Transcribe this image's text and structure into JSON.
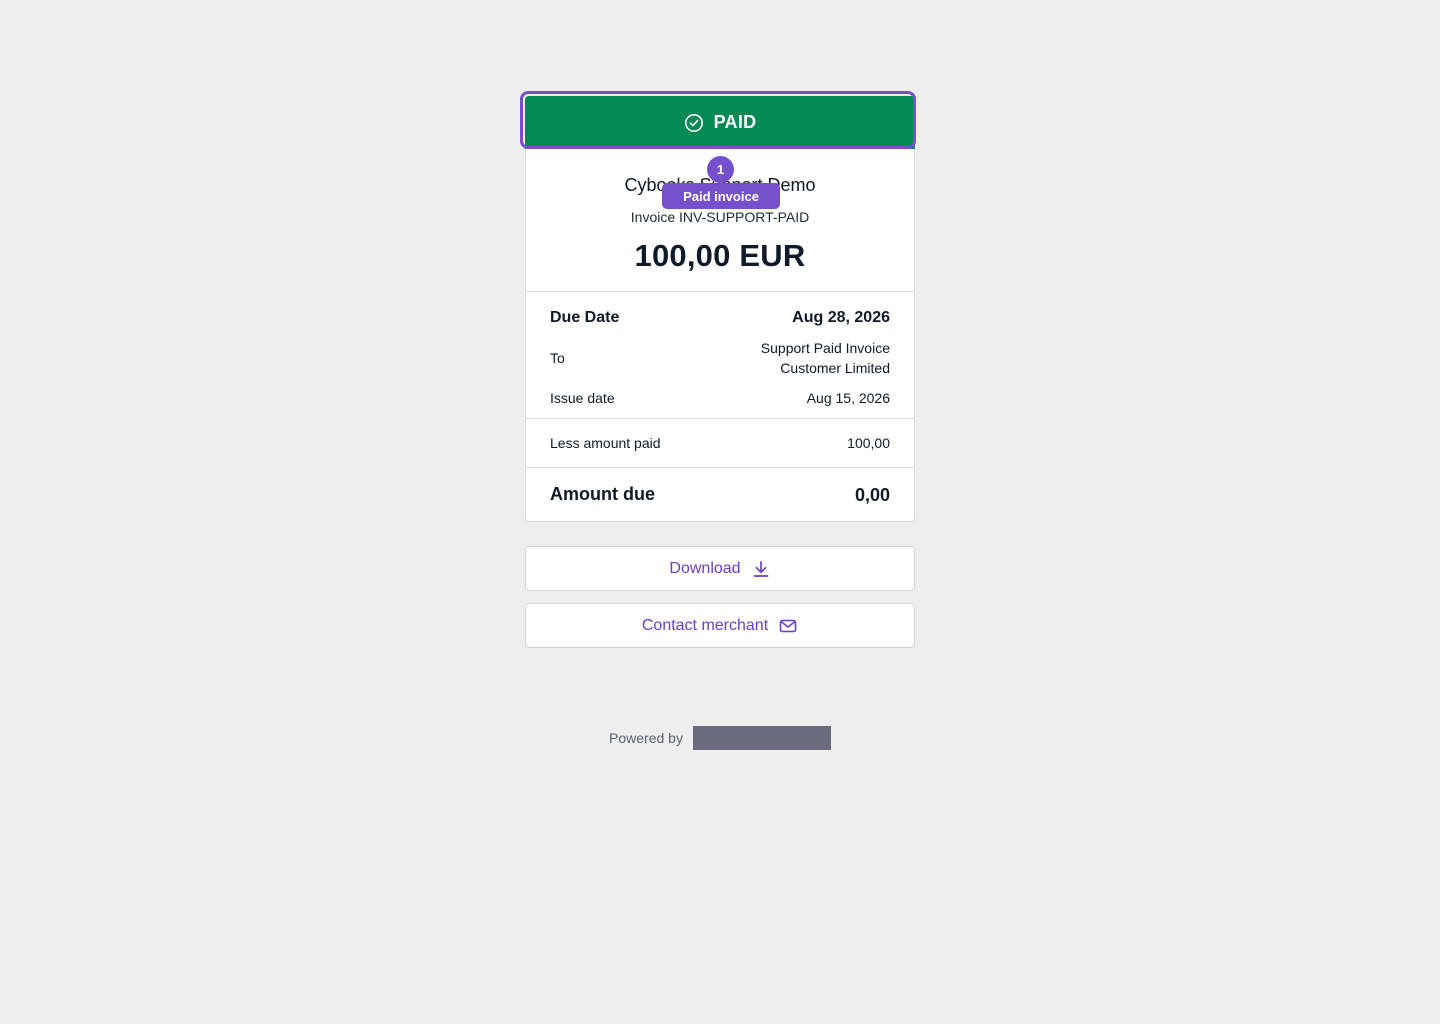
{
  "banner": {
    "status_label": "PAID",
    "status_icon": "check-circle-icon",
    "color": "#028a53"
  },
  "annotation": {
    "number": "1",
    "label": "Paid invoice",
    "color": "#7450cc"
  },
  "invoice": {
    "merchant_name": "Cybooks Support Demo",
    "invoice_number": "Invoice INV-SUPPORT-PAID",
    "total": "100,00 EUR"
  },
  "details": {
    "due_date_label": "Due Date",
    "due_date_value": "Aug 28, 2026",
    "to_label": "To",
    "to_value_line1": "Support Paid Invoice",
    "to_value_line2": "Customer Limited",
    "issue_date_label": "Issue date",
    "issue_date_value": "Aug 15, 2026"
  },
  "payments": {
    "less_paid_label": "Less amount paid",
    "less_paid_value": "100,00"
  },
  "summary": {
    "amount_due_label": "Amount due",
    "amount_due_value": "0,00"
  },
  "actions": {
    "download_label": "Download",
    "download_icon": "download-icon",
    "contact_label": "Contact merchant",
    "contact_icon": "mail-icon",
    "accent": "#6a3fc9"
  },
  "footer": {
    "powered_by": "Powered by"
  }
}
